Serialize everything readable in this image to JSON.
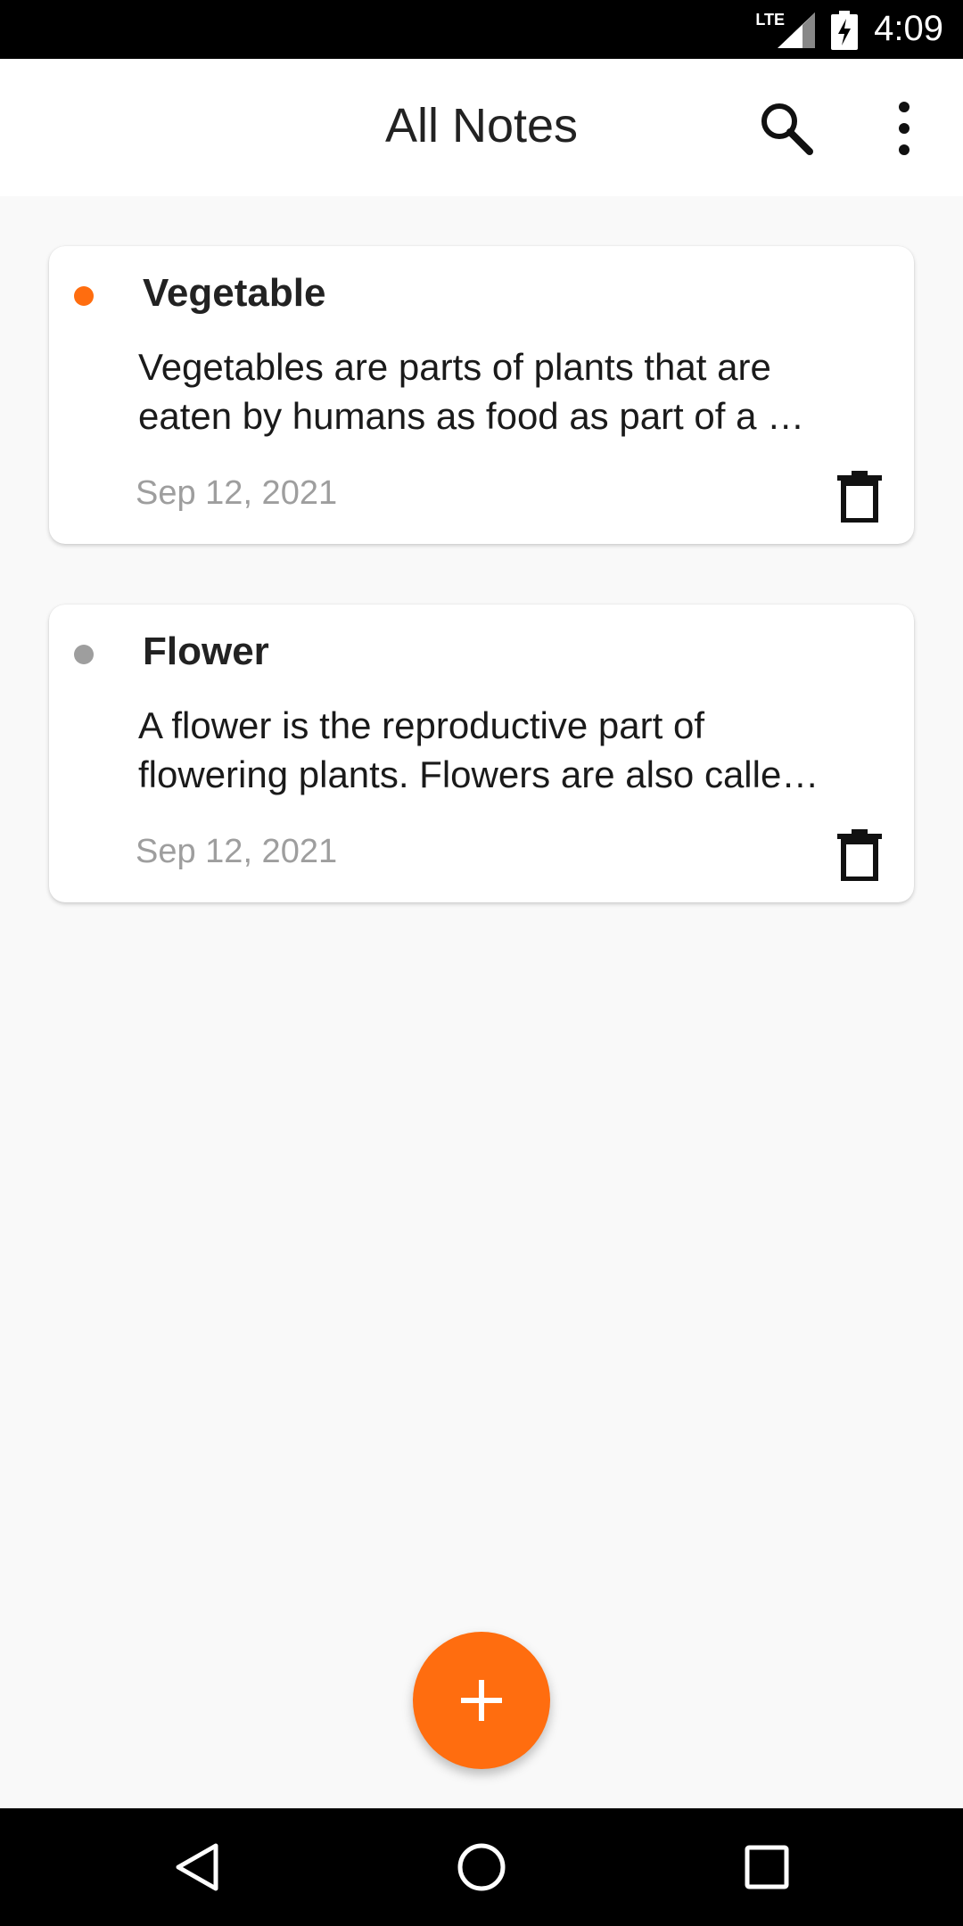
{
  "status_bar": {
    "network": "LTE",
    "time": "4:09"
  },
  "app_bar": {
    "title": "All Notes",
    "search_icon": "search-icon",
    "more_icon": "more-vert-icon"
  },
  "notes": [
    {
      "title": "Vegetable",
      "body_line1": "Vegetables are parts of plants that are",
      "body_line2": "eaten by humans as food as part of a …",
      "date": "Sep 12, 2021",
      "dot_color": "#ff6d0f"
    },
    {
      "title": "Flower",
      "body_line1": "A flower is the reproductive part of",
      "body_line2": "flowering plants. Flowers are also calle…",
      "date": "Sep 12, 2021",
      "dot_color": "#9e9e9e"
    }
  ],
  "fab": {
    "icon": "plus-icon",
    "color": "#ff6d0f"
  },
  "nav": {
    "back_icon": "back-triangle-icon",
    "home_icon": "home-circle-icon",
    "recents_icon": "recents-square-icon"
  }
}
